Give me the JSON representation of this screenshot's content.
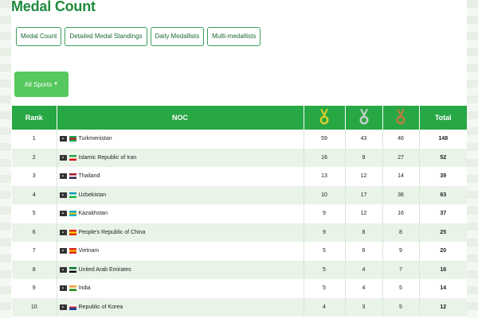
{
  "page": {
    "title": "Medal Count"
  },
  "tabs": [
    {
      "label": "Medal Count"
    },
    {
      "label": "Detailed Medal Standings"
    },
    {
      "label": "Daily Medallists"
    },
    {
      "label": "Multi-medallists"
    }
  ],
  "filter": {
    "label": "All Sports",
    "caret_icon": "caret-down-icon"
  },
  "table": {
    "header": {
      "rank": "Rank",
      "noc": "NOC",
      "total": "Total"
    },
    "medal_icons": {
      "gold": "#d6cf2a",
      "silver": "#c8cfc8",
      "bronze": "#c27a3e"
    },
    "rows": [
      {
        "rank": "1",
        "name": "Turkmenistan",
        "gold": "59",
        "silver": "43",
        "bronze": "46",
        "total": "148",
        "flag_colors": [
          "#1aa34a",
          "#c8102e",
          "#1aa34a"
        ]
      },
      {
        "rank": "2",
        "name": "Islamic Republic of Iran",
        "gold": "16",
        "silver": "9",
        "bronze": "27",
        "total": "52",
        "flag_colors": [
          "#239f40",
          "#ffffff",
          "#da0000"
        ]
      },
      {
        "rank": "3",
        "name": "Thailand",
        "gold": "13",
        "silver": "12",
        "bronze": "14",
        "total": "39",
        "flag_colors": [
          "#a51931",
          "#f4f5f8",
          "#2d2a4a"
        ]
      },
      {
        "rank": "4",
        "name": "Uzbekistan",
        "gold": "10",
        "silver": "17",
        "bronze": "36",
        "total": "63",
        "flag_colors": [
          "#0099b5",
          "#ffffff",
          "#1eb53a"
        ]
      },
      {
        "rank": "5",
        "name": "Kazakhstan",
        "gold": "9",
        "silver": "12",
        "bronze": "16",
        "total": "37",
        "flag_colors": [
          "#00afca",
          "#fec50c",
          "#00afca"
        ]
      },
      {
        "rank": "6",
        "name": "People's Republic of China",
        "gold": "9",
        "silver": "8",
        "bronze": "8",
        "total": "25",
        "flag_colors": [
          "#de2910",
          "#ffde00",
          "#de2910"
        ]
      },
      {
        "rank": "7",
        "name": "Vietnam",
        "gold": "5",
        "silver": "6",
        "bronze": "9",
        "total": "20",
        "flag_colors": [
          "#da251d",
          "#ffcd00",
          "#da251d"
        ]
      },
      {
        "rank": "8",
        "name": "United Arab Emirates",
        "gold": "5",
        "silver": "4",
        "bronze": "7",
        "total": "16",
        "flag_colors": [
          "#00732f",
          "#ffffff",
          "#000000"
        ]
      },
      {
        "rank": "9",
        "name": "India",
        "gold": "5",
        "silver": "4",
        "bronze": "5",
        "total": "14",
        "flag_colors": [
          "#ff9933",
          "#ffffff",
          "#138808"
        ]
      },
      {
        "rank": "10",
        "name": "Republic of Korea",
        "gold": "4",
        "silver": "3",
        "bronze": "5",
        "total": "12",
        "flag_colors": [
          "#ffffff",
          "#cd2e3a",
          "#0047a0"
        ]
      }
    ]
  }
}
